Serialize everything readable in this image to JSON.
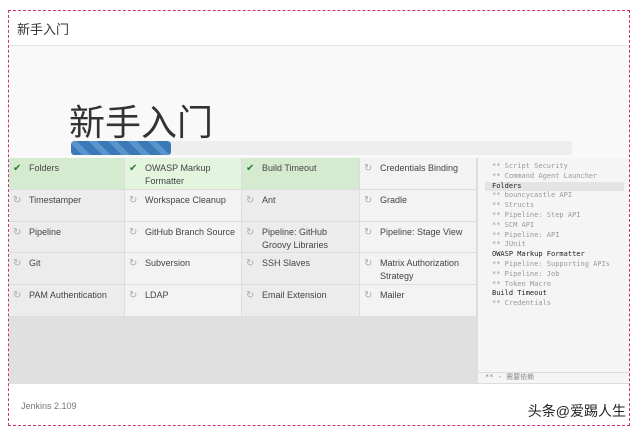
{
  "header": {
    "title": "新手入门"
  },
  "hero": {
    "title": "新手入门",
    "progress_percent": 20
  },
  "plugins": [
    {
      "label": "Folders",
      "status": "done"
    },
    {
      "label": "OWASP Markup Formatter",
      "status": "done"
    },
    {
      "label": "Build Timeout",
      "status": "done"
    },
    {
      "label": "Credentials Binding",
      "status": "pending"
    },
    {
      "label": "Timestamper",
      "status": "pending"
    },
    {
      "label": "Workspace Cleanup",
      "status": "pending"
    },
    {
      "label": "Ant",
      "status": "pending"
    },
    {
      "label": "Gradle",
      "status": "pending"
    },
    {
      "label": "Pipeline",
      "status": "pending"
    },
    {
      "label": "GitHub Branch Source",
      "status": "pending"
    },
    {
      "label": "Pipeline: GitHub Groovy Libraries",
      "status": "pending"
    },
    {
      "label": "Pipeline: Stage View",
      "status": "pending"
    },
    {
      "label": "Git",
      "status": "pending"
    },
    {
      "label": "Subversion",
      "status": "pending"
    },
    {
      "label": "SSH Slaves",
      "status": "pending"
    },
    {
      "label": "Matrix Authorization Strategy",
      "status": "pending"
    },
    {
      "label": "PAM Authentication",
      "status": "pending"
    },
    {
      "label": "LDAP",
      "status": "pending"
    },
    {
      "label": "Email Extension",
      "status": "pending"
    },
    {
      "label": "Mailer",
      "status": "pending"
    }
  ],
  "log": [
    {
      "text": "** Script Security",
      "dep": true
    },
    {
      "text": "** Command Agent Launcher",
      "dep": true
    },
    {
      "text": "Folders",
      "dep": false,
      "hl": true
    },
    {
      "text": "** bouncycastle API",
      "dep": true
    },
    {
      "text": "** Structs",
      "dep": true
    },
    {
      "text": "** Pipeline: Step API",
      "dep": true
    },
    {
      "text": "** SCM API",
      "dep": true
    },
    {
      "text": "** Pipeline: API",
      "dep": true
    },
    {
      "text": "** JUnit",
      "dep": true
    },
    {
      "text": "OWASP Markup Formatter",
      "dep": false
    },
    {
      "text": "** Pipeline: Supporting APIs",
      "dep": true
    },
    {
      "text": "** Pipeline: Job",
      "dep": true
    },
    {
      "text": "** Token Macro",
      "dep": true
    },
    {
      "text": "Build Timeout",
      "dep": false
    },
    {
      "text": "** Credentials",
      "dep": true
    }
  ],
  "log_legend": "** - 需要依赖",
  "footer": {
    "version": "Jenkins 2.109"
  },
  "watermark": "头条@爱踢人生"
}
